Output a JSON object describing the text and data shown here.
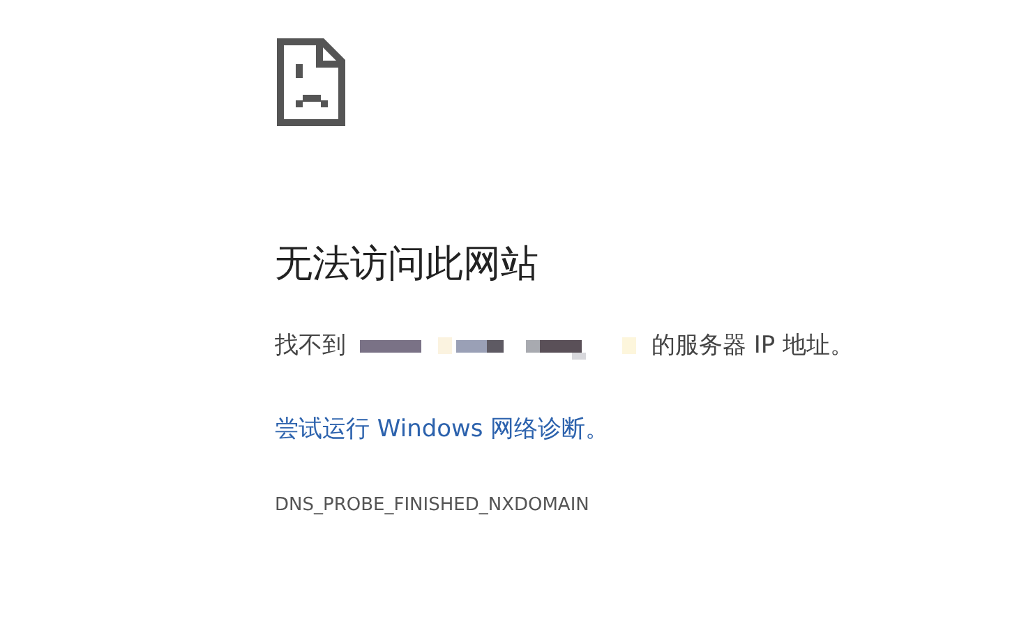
{
  "title": "无法访问此网站",
  "message": {
    "before": "找不到",
    "after": "的服务器 IP 地址。"
  },
  "suggestion_link": "尝试运行 Windows 网络诊断。",
  "error_code": "DNS_PROBE_FINISHED_NXDOMAIN"
}
